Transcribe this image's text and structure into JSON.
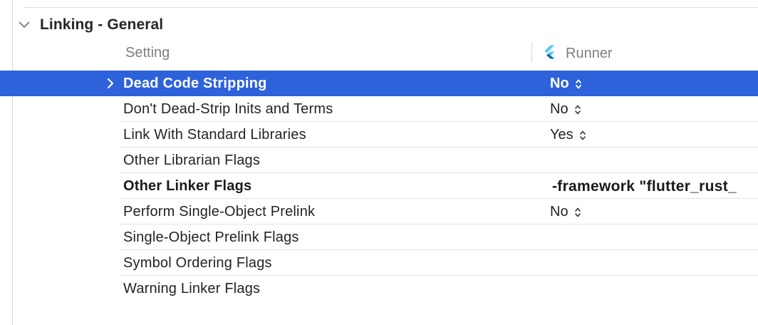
{
  "section": {
    "title": "Linking - General",
    "expanded": true
  },
  "columns": {
    "setting": "Setting",
    "target": "Runner",
    "target_icon": "flutter-icon"
  },
  "colors": {
    "selection": "#2d62da",
    "flutter_light": "#5cc8f8",
    "flutter_dark": "#0f6fb5"
  },
  "rows": [
    {
      "name": "Dead Code Stripping",
      "value": "No",
      "stepper": true,
      "selected": true,
      "expandable": true
    },
    {
      "name": "Don't Dead-Strip Inits and Terms",
      "value": "No",
      "stepper": true
    },
    {
      "name": "Link With Standard Libraries",
      "value": "Yes",
      "stepper": true
    },
    {
      "name": "Other Librarian Flags",
      "value": ""
    },
    {
      "name": "Other Linker Flags",
      "value": "-framework \"flutter_rust_",
      "bold": true
    },
    {
      "name": "Perform Single-Object Prelink",
      "value": "No",
      "stepper": true
    },
    {
      "name": "Single-Object Prelink Flags",
      "value": ""
    },
    {
      "name": "Symbol Ordering Flags",
      "value": ""
    },
    {
      "name": "Warning Linker Flags",
      "value": ""
    }
  ]
}
